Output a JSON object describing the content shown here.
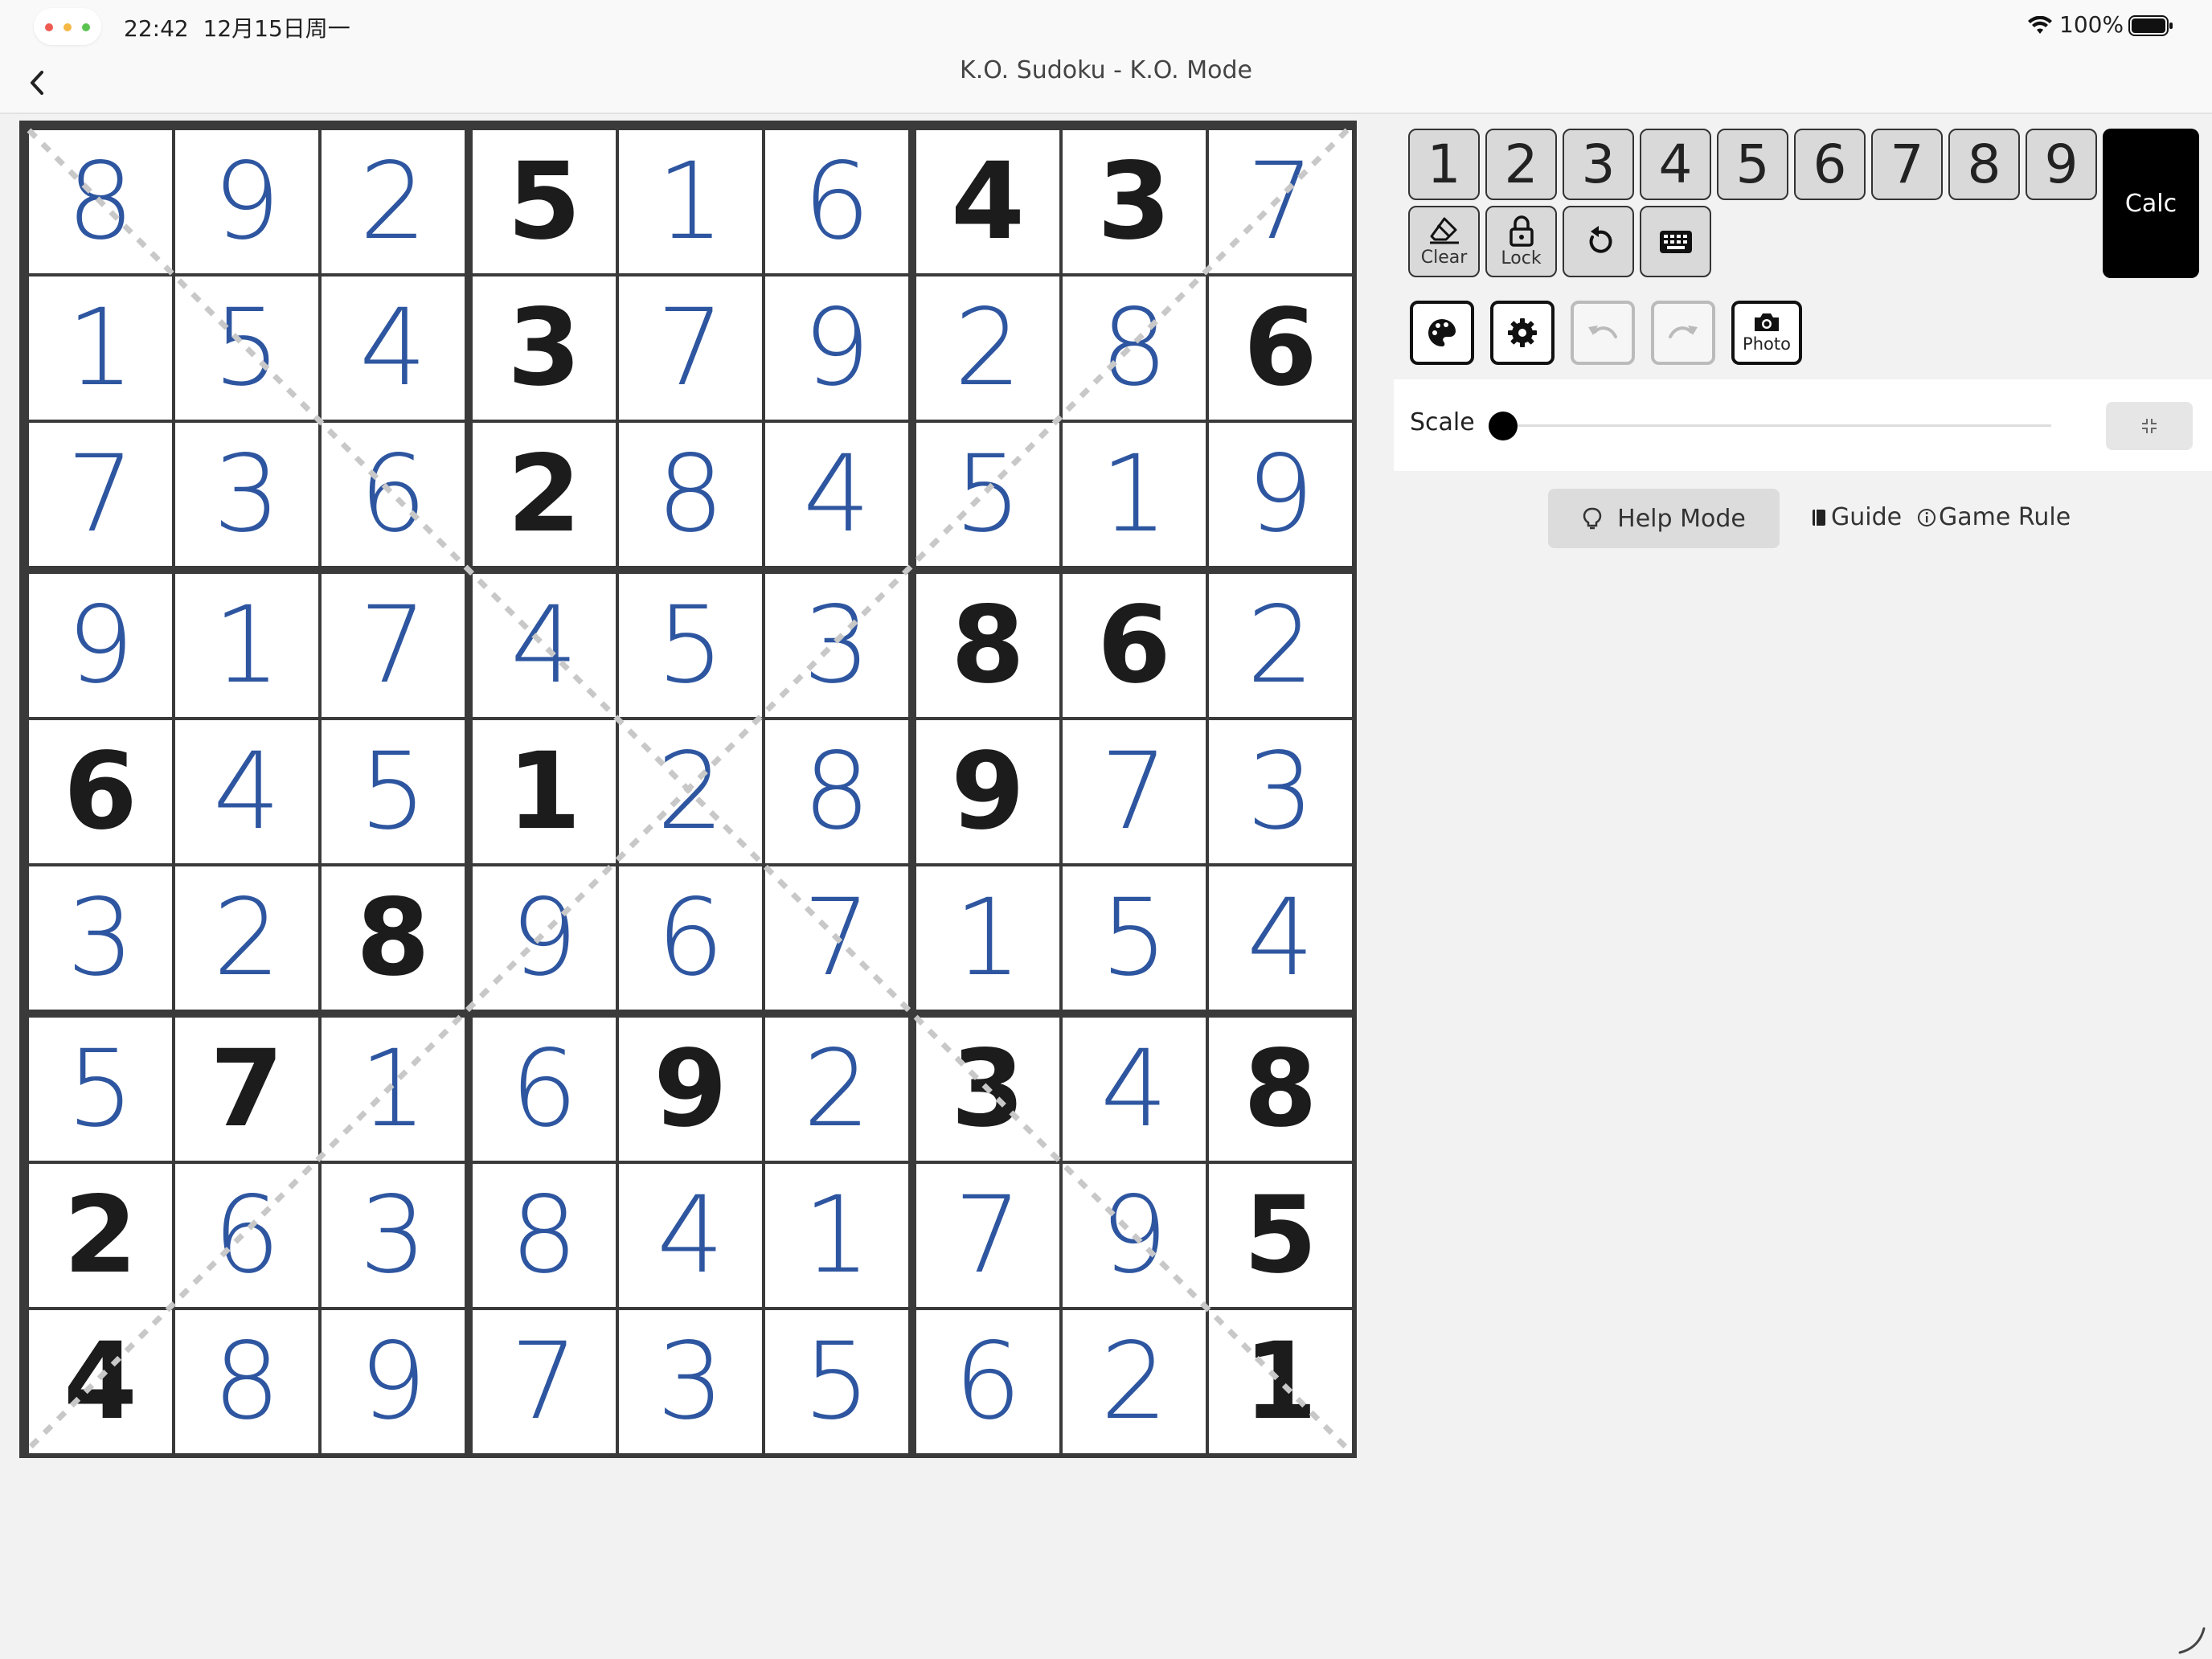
{
  "status_bar": {
    "time": "22:42",
    "date": "12月15日周一",
    "battery": "100%"
  },
  "nav": {
    "title": "K.O. Sudoku - K.O. Mode"
  },
  "board": {
    "values": [
      [
        8,
        9,
        2,
        5,
        1,
        6,
        4,
        3,
        7
      ],
      [
        1,
        5,
        4,
        3,
        7,
        9,
        2,
        8,
        6
      ],
      [
        7,
        3,
        6,
        2,
        8,
        4,
        5,
        1,
        9
      ],
      [
        9,
        1,
        7,
        4,
        5,
        3,
        8,
        6,
        2
      ],
      [
        6,
        4,
        5,
        1,
        2,
        8,
        9,
        7,
        3
      ],
      [
        3,
        2,
        8,
        9,
        6,
        7,
        1,
        5,
        4
      ],
      [
        5,
        7,
        1,
        6,
        9,
        2,
        3,
        4,
        8
      ],
      [
        2,
        6,
        3,
        8,
        4,
        1,
        7,
        9,
        5
      ],
      [
        4,
        8,
        9,
        7,
        3,
        5,
        6,
        2,
        1
      ]
    ],
    "givens": [
      [
        0,
        0,
        0,
        1,
        0,
        0,
        1,
        1,
        0
      ],
      [
        0,
        0,
        0,
        1,
        0,
        0,
        0,
        0,
        1
      ],
      [
        0,
        0,
        0,
        1,
        0,
        0,
        0,
        0,
        0
      ],
      [
        0,
        0,
        0,
        0,
        0,
        0,
        1,
        1,
        0
      ],
      [
        1,
        0,
        0,
        1,
        0,
        0,
        1,
        0,
        0
      ],
      [
        0,
        0,
        1,
        0,
        0,
        0,
        0,
        0,
        0
      ],
      [
        0,
        1,
        0,
        0,
        1,
        0,
        1,
        0,
        1
      ],
      [
        1,
        0,
        0,
        0,
        0,
        0,
        0,
        0,
        1
      ],
      [
        1,
        0,
        0,
        0,
        0,
        0,
        0,
        0,
        1
      ]
    ],
    "user_color": "#2e56a0",
    "given_color": "#1c1c1c",
    "diagonal_color": "#c8c8c8"
  },
  "keypad": {
    "numbers": [
      "1",
      "2",
      "3",
      "4",
      "5",
      "6",
      "7",
      "8",
      "9"
    ],
    "calc_label": "Calc"
  },
  "tools": {
    "clear_label": "Clear",
    "lock_label": "Lock",
    "reset_icon": "rotate-icon",
    "keyboard_icon": "keyboard-icon"
  },
  "actions": {
    "palette_icon": "palette-icon",
    "settings_icon": "gear-icon",
    "undo_icon": "undo-icon",
    "redo_icon": "redo-icon",
    "photo_label": "Photo"
  },
  "scale": {
    "label": "Scale",
    "value": 0
  },
  "help": {
    "help_mode_label": "Help Mode",
    "guide_label": "Guide",
    "game_rule_label": "Game Rule"
  }
}
